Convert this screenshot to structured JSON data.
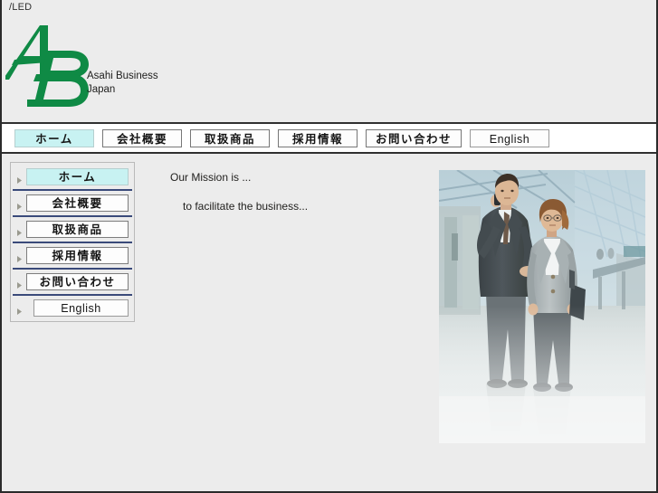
{
  "window": {
    "address_text": "/LED"
  },
  "header": {
    "logo_icon": "ab-monogram-logo",
    "brand_line1": "Asahi Business",
    "brand_line2": "Japan",
    "brand_green": "#0f8a45"
  },
  "nav": {
    "items": [
      {
        "label": "ホーム",
        "active": true,
        "lang": "jp"
      },
      {
        "label": "会社概要",
        "active": false,
        "lang": "jp"
      },
      {
        "label": "取扱商品",
        "active": false,
        "lang": "jp"
      },
      {
        "label": "採用情報",
        "active": false,
        "lang": "jp"
      },
      {
        "label": "お問い合わせ",
        "active": false,
        "lang": "jp"
      },
      {
        "label": "English",
        "active": false,
        "lang": "en"
      }
    ]
  },
  "sidebar": {
    "bullet_icon": "triangle-right-icon",
    "items": [
      {
        "label": "ホーム",
        "active": true,
        "lang": "jp"
      },
      {
        "label": "会社概要",
        "active": false,
        "lang": "jp"
      },
      {
        "label": "取扱商品",
        "active": false,
        "lang": "jp"
      },
      {
        "label": "採用情報",
        "active": false,
        "lang": "jp"
      },
      {
        "label": "お問い合わせ",
        "active": false,
        "lang": "jp"
      },
      {
        "label": "English",
        "active": false,
        "lang": "en"
      }
    ]
  },
  "main": {
    "mission_heading": "Our Mission is ...",
    "mission_body": "to facilitate the business..."
  },
  "photo": {
    "alt": "two business people walking through a modern glass atrium, man on mobile phone"
  },
  "colors": {
    "page_background": "#ececec",
    "nav_background": "#ffffff",
    "accent_active": "#c8f2f2",
    "rule_dark": "#303030",
    "separator_navy": "#3a4a7a",
    "brand_green": "#0f8a45"
  }
}
